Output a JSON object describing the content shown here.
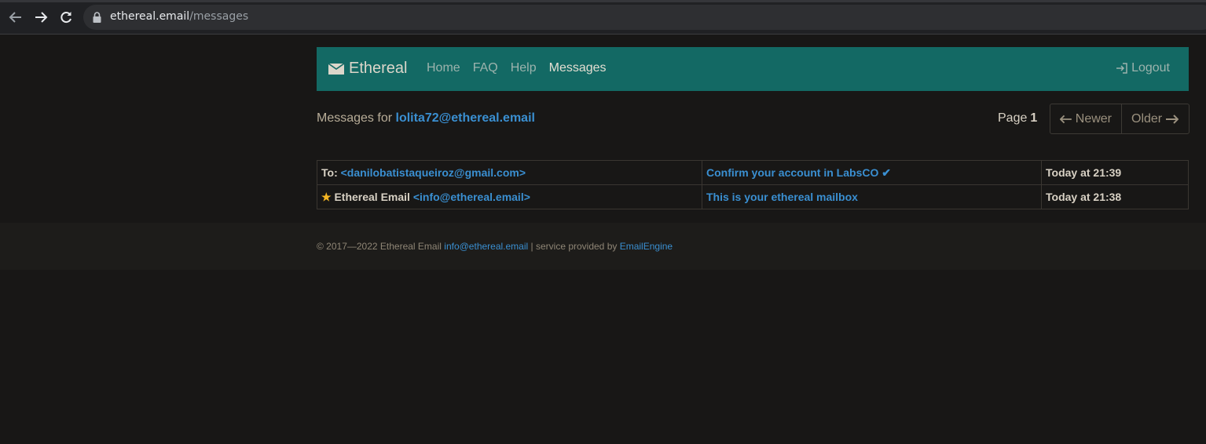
{
  "browser": {
    "url_host": "ethereal.email",
    "url_path": "/messages"
  },
  "navbar": {
    "brand": "Ethereal",
    "menu": [
      {
        "label": "Home",
        "active": false
      },
      {
        "label": "FAQ",
        "active": false
      },
      {
        "label": "Help",
        "active": false
      },
      {
        "label": "Messages",
        "active": true
      }
    ],
    "logout": "Logout"
  },
  "header": {
    "prefix": "Messages for",
    "email": "lolita72@ethereal.email"
  },
  "pagination": {
    "label": "Page",
    "page": "1",
    "newer": "Newer",
    "older": "Older"
  },
  "messages": [
    {
      "from_prefix": "To:",
      "from_name": "",
      "from_email": "<danilobatistaqueiroz@gmail.com>",
      "starred": false,
      "subject": "Confirm your account in LabsCO ✔",
      "date": "Today at 21:39"
    },
    {
      "from_prefix": "",
      "from_name": "Ethereal Email",
      "from_email": "<info@ethereal.email>",
      "starred": true,
      "subject": "This is your ethereal mailbox",
      "date": "Today at 21:38"
    }
  ],
  "footer": {
    "copyright": "© 2017—2022 Ethereal Email",
    "email": "info@ethereal.email",
    "separator": "| service provided by",
    "provider": "EmailEngine"
  },
  "colors": {
    "navbar": "#136964",
    "link": "#3a8fd1",
    "star": "#f5b623",
    "background": "#181716"
  },
  "icons": [
    "back-arrow-icon",
    "forward-arrow-icon",
    "reload-icon",
    "lock-icon",
    "envelope-icon",
    "logout-icon",
    "arrow-left-icon",
    "arrow-right-icon",
    "star-icon"
  ]
}
